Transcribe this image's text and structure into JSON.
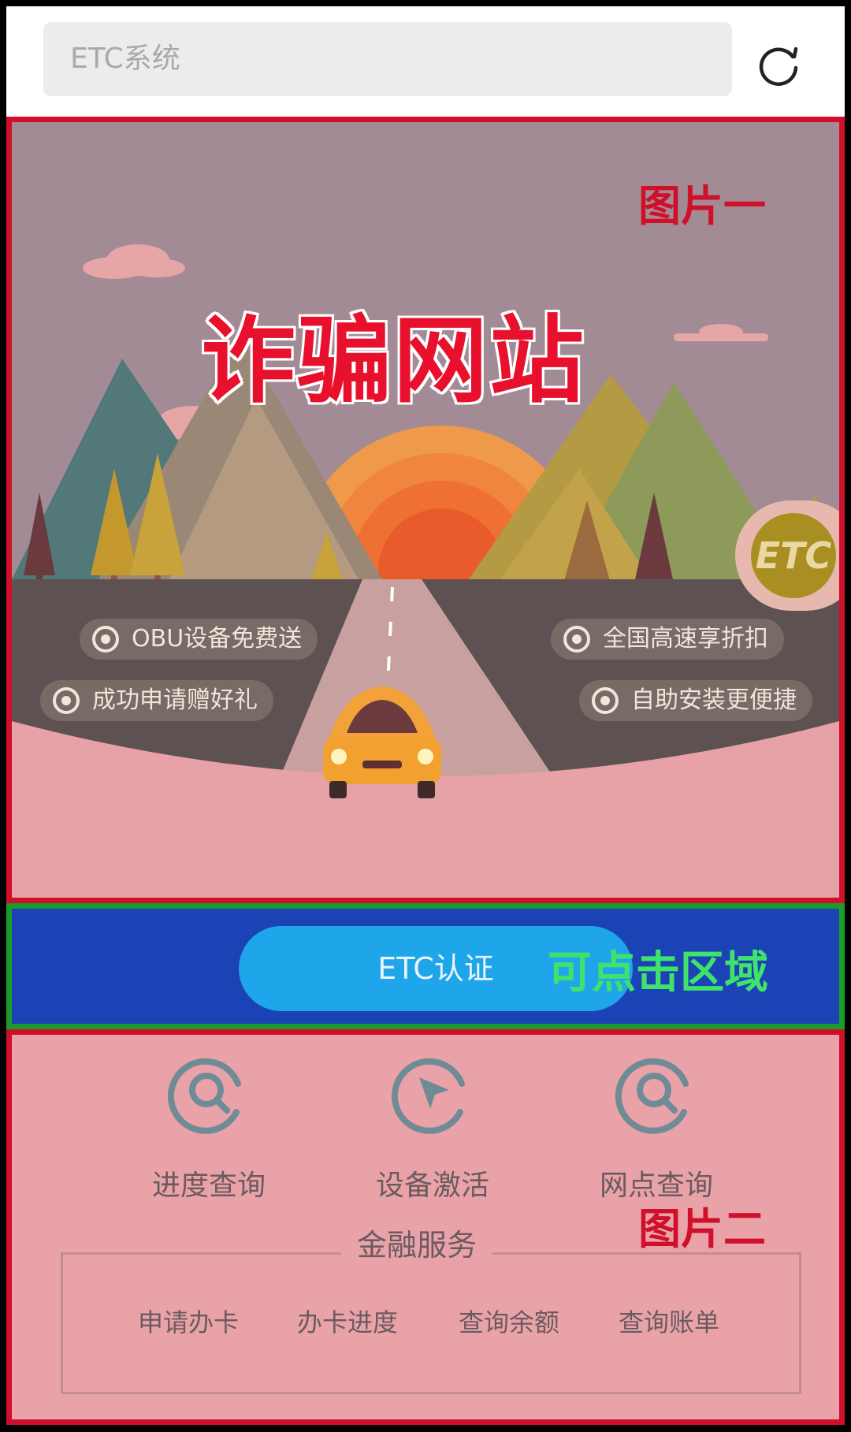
{
  "search": {
    "placeholder": "ETC系统"
  },
  "panel_one": {
    "label": "图片一",
    "warning": "诈骗网站",
    "badge": "ETC",
    "features": [
      "OBU设备免费送",
      "全国高速享折扣",
      "成功申请赠好礼",
      "自助安装更便捷"
    ]
  },
  "clickable_area": {
    "button_label": "ETC认证",
    "label": "可点击区域"
  },
  "panel_two": {
    "label": "图片二",
    "services": [
      "进度查询",
      "设备激活",
      "网点查询"
    ],
    "finance_title": "金融服务",
    "finance_items": [
      "申请办卡",
      "办卡进度",
      "查询余额",
      "查询账单"
    ]
  },
  "colors": {
    "annotation_red": "#d0102a",
    "annotation_green": "#1a9c2a",
    "button_blue": "#1fa6ea",
    "clickable_bg": "#1b43b5"
  }
}
